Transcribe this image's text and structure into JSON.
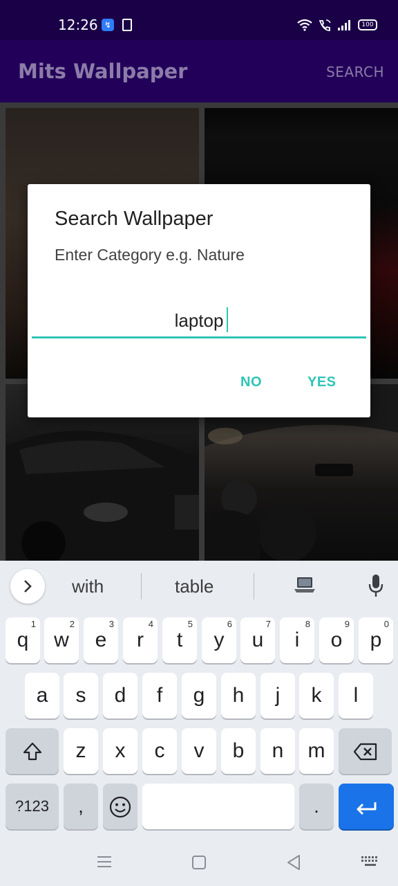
{
  "status_bar": {
    "time": "12:26",
    "battery": "100"
  },
  "app_bar": {
    "title": "Mits Wallpaper",
    "action": "SEARCH"
  },
  "dialog": {
    "title": "Search Wallpaper",
    "message": "Enter Category e.g. Nature",
    "input_value": "laptop",
    "negative_button": "NO",
    "positive_button": "YES"
  },
  "keyboard": {
    "suggestions": [
      "with",
      "table"
    ],
    "row1": [
      {
        "k": "q",
        "h": "1"
      },
      {
        "k": "w",
        "h": "2"
      },
      {
        "k": "e",
        "h": "3"
      },
      {
        "k": "r",
        "h": "4"
      },
      {
        "k": "t",
        "h": "5"
      },
      {
        "k": "y",
        "h": "6"
      },
      {
        "k": "u",
        "h": "7"
      },
      {
        "k": "i",
        "h": "8"
      },
      {
        "k": "o",
        "h": "9"
      },
      {
        "k": "p",
        "h": "0"
      }
    ],
    "row2": [
      "a",
      "s",
      "d",
      "f",
      "g",
      "h",
      "j",
      "k",
      "l"
    ],
    "row3": [
      "z",
      "x",
      "c",
      "v",
      "b",
      "n",
      "m"
    ],
    "symbols_key": "?123",
    "comma_key": ",",
    "period_key": "."
  },
  "colors": {
    "status_bar": "#190047",
    "app_bar": "#22005a",
    "accent": "#2ec4b6",
    "enter_key": "#1a73e8"
  }
}
